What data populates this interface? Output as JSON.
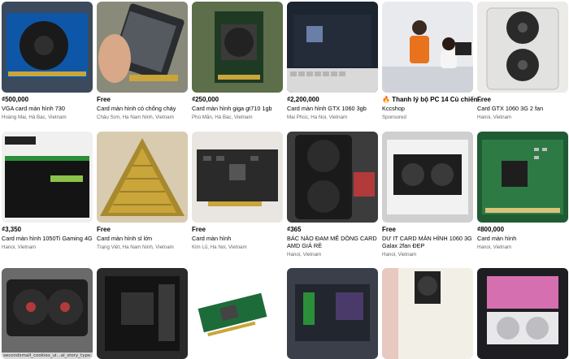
{
  "listings": [
    {
      "price": "₫500,000",
      "title": "VGA card màn hình 730",
      "location": "Hoàng Mai, Hà Bac, Vietnam"
    },
    {
      "price": "Free",
      "title": "Card màn hình cỏ chống cháy",
      "location": "Châu Sơn, Ha Nam Ninh, Vietnam"
    },
    {
      "price": "₫250,000",
      "title": "Card màn hình giga gt710 1gb",
      "location": "Phú Mãn, Hà Bac, Vietnam"
    },
    {
      "price": "₫2,200,000",
      "title": "Card màn hình GTX 1060 3gb",
      "location": "Mai Phúc, Ha Noi, Vietnam"
    },
    {
      "price": "🔥 Thanh lý bộ PC 14 Củ chiến...",
      "title": "Kccshop",
      "location": "Sponsored"
    },
    {
      "price": "Free",
      "title": "Card GTX 1060 3G 2 fan",
      "location": "Hanoi, Vietnam"
    },
    {
      "price": "₫3,350",
      "title": "Card màn hình 1050Ti Gaming 4G",
      "location": "Hanoi, Vietnam"
    },
    {
      "price": "Free",
      "title": "Card màn hình sl lớn",
      "location": "Trạng Việt, Ha Nam Ninh, Vietnam"
    },
    {
      "price": "Free",
      "title": "Card màn hình",
      "location": "Kim Lũ, Ha Noi, Vietnam"
    },
    {
      "price": "₫365",
      "title": "BÁC NÀO ĐAM MÊ DÒNG CARD AMD GIÁ RẺ",
      "location": "Hanoi, Vietnam"
    },
    {
      "price": "Free",
      "title": "DƯ IT CARD MÀN HÌNH 1060 3G Galax 2fan ĐẸP",
      "location": "Hanoi, Vietnam"
    },
    {
      "price": "₫800,000",
      "title": "Card màn hình",
      "location": "Hanoi, Vietnam"
    }
  ],
  "row3_caption": "secondsmall_cookies_ui...al_story_type..."
}
